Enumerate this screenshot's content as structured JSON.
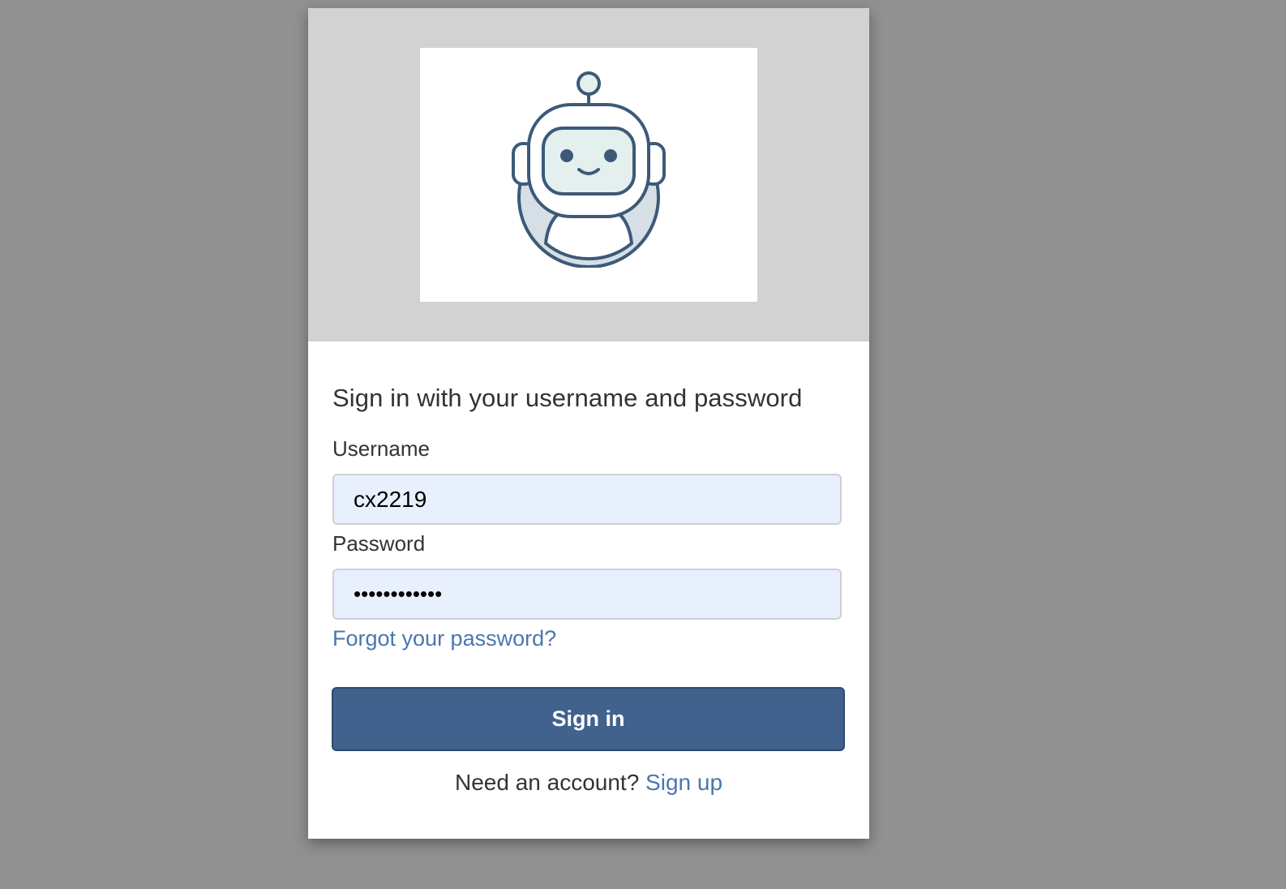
{
  "login": {
    "logo": "robot-logo",
    "heading": "Sign in with your username and password",
    "username": {
      "label": "Username",
      "value": "cx2219"
    },
    "password": {
      "label": "Password",
      "value": "••••••••••••"
    },
    "forgot_link": "Forgot your password?",
    "signin_button": "Sign in",
    "signup_prompt": "Need an account?",
    "signup_link": "Sign up"
  },
  "colors": {
    "page_background": "#919191",
    "banner_background": "#d2d2d2",
    "primary_button": "#41628c",
    "link": "#4a76ae",
    "input_fill": "#e8f0fe",
    "logo_stroke": "#3c5a78"
  }
}
